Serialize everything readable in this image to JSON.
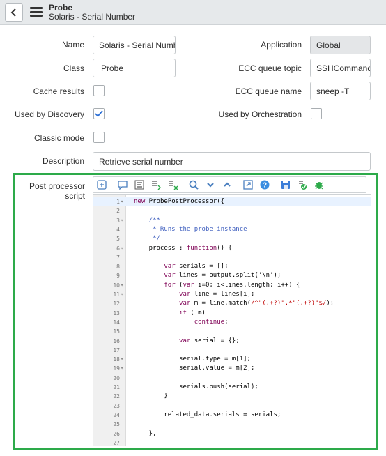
{
  "header": {
    "title": "Probe",
    "subtitle": "Solaris - Serial Number"
  },
  "form": {
    "name_label": "Name",
    "name_value": "Solaris - Serial Number",
    "application_label": "Application",
    "application_value": "Global",
    "class_label": "Class",
    "class_value": "Probe",
    "ecc_topic_label": "ECC queue topic",
    "ecc_topic_value": "SSHCommand",
    "cache_label": "Cache results",
    "cache_checked": false,
    "ecc_name_label": "ECC queue name",
    "ecc_name_value": "sneep -T",
    "discovery_label": "Used by Discovery",
    "discovery_checked": true,
    "orchestration_label": "Used by Orchestration",
    "orchestration_checked": false,
    "classic_label": "Classic mode",
    "classic_checked": false,
    "description_label": "Description",
    "description_value": "Retrieve serial number",
    "script_label": "Post processor script"
  },
  "toolbar_icons": [
    "toggle-syntax-icon",
    "comment-icon",
    "format-icon",
    "insert-comment-icon",
    "remove-comment-icon",
    "search-icon",
    "find-next-icon",
    "find-previous-icon",
    "fullscreen-icon",
    "help-icon",
    "save-icon",
    "script-debugger-icon",
    "syntax-check-icon"
  ],
  "code_lines": [
    {
      "n": "1",
      "fold": true,
      "text": "new ProbePostProcessor({"
    },
    {
      "n": "2",
      "fold": false,
      "text": ""
    },
    {
      "n": "3",
      "fold": true,
      "text": "    /**"
    },
    {
      "n": "4",
      "fold": false,
      "text": "     * Runs the probe instance"
    },
    {
      "n": "5",
      "fold": false,
      "text": "     */"
    },
    {
      "n": "6",
      "fold": true,
      "text": "    process : function() {"
    },
    {
      "n": "7",
      "fold": false,
      "text": ""
    },
    {
      "n": "8",
      "fold": false,
      "text": "        var serials = [];"
    },
    {
      "n": "9",
      "fold": false,
      "text": "        var lines = output.split('\\n');"
    },
    {
      "n": "10",
      "fold": true,
      "text": "        for (var i=0; i<lines.length; i++) {"
    },
    {
      "n": "11",
      "fold": true,
      "text": "            var line = lines[i];"
    },
    {
      "n": "12",
      "fold": false,
      "text": "            var m = line.match(/^\"(.+?)\".*\"(.+?)\"$/);"
    },
    {
      "n": "13",
      "fold": false,
      "text": "            if (!m)"
    },
    {
      "n": "14",
      "fold": false,
      "text": "                continue;"
    },
    {
      "n": "15",
      "fold": false,
      "text": ""
    },
    {
      "n": "16",
      "fold": false,
      "text": "            var serial = {};"
    },
    {
      "n": "17",
      "fold": false,
      "text": ""
    },
    {
      "n": "18",
      "fold": true,
      "text": "            serial.type = m[1];"
    },
    {
      "n": "19",
      "fold": true,
      "text": "            serial.value = m[2];"
    },
    {
      "n": "20",
      "fold": false,
      "text": ""
    },
    {
      "n": "21",
      "fold": false,
      "text": "            serials.push(serial);"
    },
    {
      "n": "22",
      "fold": false,
      "text": "        }"
    },
    {
      "n": "23",
      "fold": false,
      "text": ""
    },
    {
      "n": "24",
      "fold": false,
      "text": "        related_data.serials = serials;"
    },
    {
      "n": "25",
      "fold": false,
      "text": ""
    },
    {
      "n": "26",
      "fold": false,
      "text": "    },"
    },
    {
      "n": "27",
      "fold": false,
      "text": ""
    }
  ],
  "colors": {
    "highlight_border": "#2daa4a",
    "checkbox_check": "#2b6fd6",
    "header_bg": "#e6e9eb"
  }
}
